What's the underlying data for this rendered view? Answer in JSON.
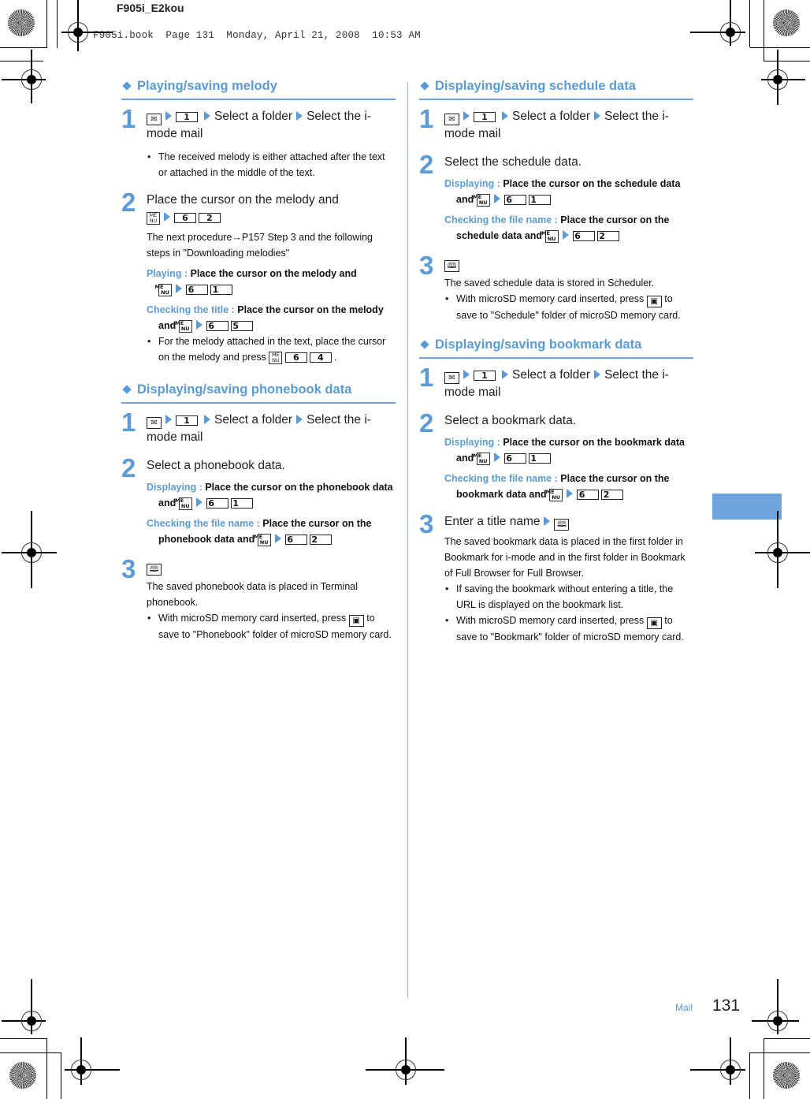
{
  "header": {
    "doc_name": "F905i_E2kou",
    "meta": "F905i.book  Page 131  Monday, April 21, 2008  10:53 AM"
  },
  "left": {
    "melody": {
      "title": "Playing/saving melody",
      "step1": {
        "num": "1",
        "key1": "1",
        "text_a": "Select a folder",
        "text_b": "Select the i-mode mail",
        "bullet": "The received melody is either attached after the text or attached in the middle of the text."
      },
      "step2": {
        "num": "2",
        "text": "Place the cursor on the melody and",
        "keys": [
          "6",
          "2"
        ],
        "para": "The next procedure→P157 Step 3 and the following steps in \"Downloading melodies\"",
        "playing_label": "Playing : ",
        "playing_text": "Place the cursor on the melody and",
        "playing_keys": [
          "6",
          "1"
        ],
        "title_label": "Checking the title : ",
        "title_text": "Place the cursor on the melody and",
        "title_keys": [
          "6",
          "5"
        ],
        "bullet_text": "For the melody attached in the text, place the cursor on the melody and press",
        "bullet_keys": [
          "6",
          "4"
        ]
      }
    },
    "phonebook": {
      "title": "Displaying/saving phonebook data",
      "step1": {
        "num": "1",
        "key1": "1",
        "text_a": "Select a folder",
        "text_b": "Select the i-mode mail"
      },
      "step2": {
        "num": "2",
        "text": "Select a phonebook data.",
        "disp_label": "Displaying : ",
        "disp_text": "Place the cursor on the phonebook data and",
        "disp_keys": [
          "6",
          "1"
        ],
        "file_label": "Checking the file name : ",
        "file_text": "Place the cursor on the phonebook data and",
        "file_keys": [
          "6",
          "2"
        ]
      },
      "step3": {
        "num": "3",
        "para": "The saved phonebook data is placed in Terminal phonebook.",
        "bullet_a": "With microSD memory card inserted, press",
        "bullet_b": "to save to \"Phonebook\" folder of microSD memory card."
      }
    }
  },
  "right": {
    "schedule": {
      "title": "Displaying/saving schedule data",
      "step1": {
        "num": "1",
        "key1": "1",
        "text_a": "Select a folder",
        "text_b": "Select the i-mode mail"
      },
      "step2": {
        "num": "2",
        "text": "Select the schedule data.",
        "disp_label": "Displaying : ",
        "disp_text": "Place the cursor on the schedule data and",
        "disp_keys": [
          "6",
          "1"
        ],
        "file_label": "Checking the file name : ",
        "file_text": "Place the cursor on the schedule data and",
        "file_keys": [
          "6",
          "2"
        ]
      },
      "step3": {
        "num": "3",
        "para": "The saved schedule data is stored in Scheduler.",
        "bullet_a": "With microSD memory card inserted, press",
        "bullet_b": "to save to \"Schedule\" folder of microSD memory card."
      }
    },
    "bookmark": {
      "title": "Displaying/saving bookmark data",
      "step1": {
        "num": "1",
        "key1": "1",
        "text_a": "Select a folder",
        "text_b": "Select the i-mode mail"
      },
      "step2": {
        "num": "2",
        "text": "Select a bookmark data.",
        "disp_label": "Displaying : ",
        "disp_text": "Place the cursor on the bookmark data and",
        "disp_keys": [
          "6",
          "1"
        ],
        "file_label": "Checking the file name : ",
        "file_text": "Place the cursor on the bookmark data and",
        "file_keys": [
          "6",
          "2"
        ]
      },
      "step3": {
        "num": "3",
        "text": "Enter a title name",
        "para": "The saved bookmark data is placed in the first folder in Bookmark for i-mode and in the first folder in Bookmark of Full Browser for Full Browser.",
        "bullet1": "If saving the bookmark without entering a title, the URL is displayed on the bookmark list.",
        "bullet_a": "With microSD memory card inserted, press",
        "bullet_b": "to save to \"Bookmark\" folder of microSD memory card."
      }
    }
  },
  "footer": {
    "section": "Mail",
    "page": "131"
  },
  "icons": {
    "mail": "mail-key-icon",
    "menu": "menu-key-icon",
    "save": "book-save-icon",
    "microsd": "microsd-key-icon"
  },
  "colors": {
    "accent": "#5b9bd5",
    "tab": "#6fa3dc"
  }
}
